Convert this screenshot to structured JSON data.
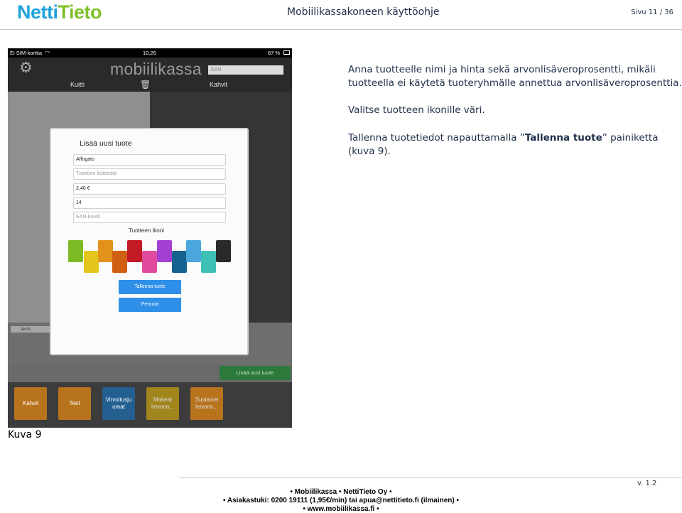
{
  "header": {
    "logo_part1": "Netti",
    "logo_part2": "Tieto",
    "doc_title": "Mobiilikassakoneen käyttöohje",
    "page": "Sivu 11 / 36"
  },
  "screenshot": {
    "status": {
      "carrier": "Ei SIM-korttia",
      "time": "10.26",
      "battery": "67 %"
    },
    "brand": "mobiilikassa",
    "ean_placeholder": "EAN",
    "tab_kuitti": "Kuitti",
    "tab_kahvit": "Kahvit",
    "alv_label": "alv%",
    "add_new_button": "Lisää uusi tuote",
    "tiles": [
      {
        "label": "Kahvit",
        "color": "#e08a1e"
      },
      {
        "label": "Teet",
        "color": "#e08a1e"
      },
      {
        "label": "Virvoitusju omat",
        "color": "#2a7bbf"
      },
      {
        "label": "Makeat leivonn...",
        "color": "#c9a21d"
      },
      {
        "label": "Suolaiset leivonn...",
        "color": "#e08a1e"
      }
    ],
    "modal": {
      "title": "Lisää uusi tuote",
      "name_value": "Affogato",
      "extra_placeholder": "Tuotteen lisätiedot",
      "price_value": "2,40 €",
      "vat_value": "14",
      "ean_placeholder": "EAN-koodi",
      "icon_label": "Tuotteen ikoni",
      "swatches_top": [
        "#7dbb26",
        "#e3911b",
        "#c41a25",
        "#a43fd1",
        "#4aa6dd",
        "#2a2a2a"
      ],
      "swatches_bottom": [
        "#e3c61c",
        "#d05f12",
        "#e04a9c",
        "#15628e",
        "#3fc0b5"
      ],
      "save_button": "Tallenna tuote",
      "cancel_button": "Peruuta"
    }
  },
  "caption": "Kuva 9",
  "paragraphs": {
    "p1": "Anna tuotteelle nimi ja hinta sekä arvonlisäveroprosentti, mikäli tuotteella ei käytetä tuoteryhmälle annettua arvonlisäveroprosenttia.",
    "p2": "Valitse tuotteen ikonille väri.",
    "p3_before": "Tallenna tuotetiedot napauttamalla ”",
    "p3_bold": "Tallenna tuote",
    "p3_after": "” painiketta (kuva 9)."
  },
  "footer": {
    "version": "v. 1.2",
    "line1": "Mobiilikassa  •  NettiTieto Oy  •",
    "line2": "Asiakastuki: 0200 19111 (1,95€/min)  tai  apua@nettitieto.fi (ilmainen)  •",
    "line3": "www.mobiilikassa.fi  •"
  }
}
